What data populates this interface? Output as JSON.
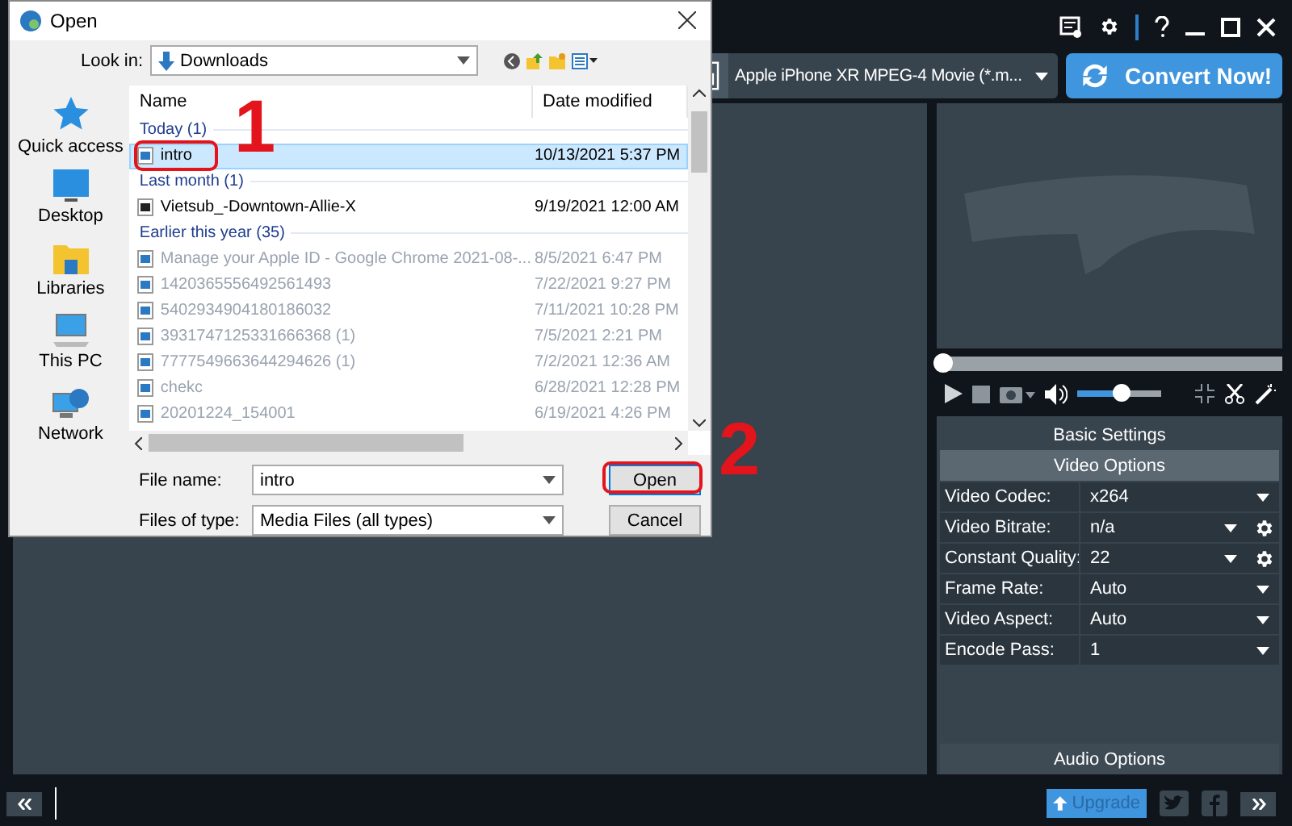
{
  "app": {
    "profile": "Apple iPhone XR MPEG-4 Movie (*.m...",
    "convert_button": "Convert Now!"
  },
  "player": {
    "seek": {
      "level": 0
    },
    "volume": {
      "level": 0.52
    }
  },
  "settings": {
    "sections": [
      {
        "title": "Basic Settings",
        "expanded": false
      },
      {
        "title": "Video Options",
        "expanded": true
      }
    ],
    "rows": [
      {
        "label": "Video Codec:",
        "value": "x264",
        "kind": "plain"
      },
      {
        "label": "Video Bitrate:",
        "value": "n/a",
        "kind": "gear"
      },
      {
        "label": "Constant Quality:",
        "value": "22",
        "kind": "gear"
      },
      {
        "label": "Frame Rate:",
        "value": "Auto",
        "kind": "plain"
      },
      {
        "label": "Video Aspect:",
        "value": "Auto",
        "kind": "plain"
      },
      {
        "label": "Encode Pass:",
        "value": "1",
        "kind": "plain"
      }
    ],
    "footer_section": {
      "title": "Audio Options",
      "expanded": false
    }
  },
  "bottom_bar": {
    "upgrade_button": "Upgrade"
  },
  "dialog": {
    "title": "Open",
    "look_in_label": "Look in:",
    "look_in": "Downloads",
    "places": [
      {
        "label": "Quick access",
        "kind": "star"
      },
      {
        "label": "Desktop",
        "kind": "desktop"
      },
      {
        "label": "Libraries",
        "kind": "folder"
      },
      {
        "label": "This PC",
        "kind": "pc"
      },
      {
        "label": "Network",
        "kind": "network"
      }
    ],
    "columns": [
      "Name",
      "Date modified"
    ],
    "groups": [
      {
        "title": "Today (1)",
        "files": [
          {
            "name": "intro",
            "date": "10/13/2021 5:37 PM",
            "selected": true,
            "kind": "video"
          }
        ]
      },
      {
        "title": "Last month (1)",
        "files": [
          {
            "name": "Vietsub_-Downtown-Allie-X",
            "date": "9/19/2021 12:00 AM",
            "selected": false,
            "kind": "audio"
          }
        ]
      },
      {
        "title": "Earlier this year (35)",
        "files": [
          {
            "name": "Manage your Apple ID - Google Chrome 2021-08-...",
            "date": "8/5/2021 6:47 PM",
            "selected": false,
            "kind": "video"
          },
          {
            "name": "1420365556492561493",
            "date": "7/22/2021 9:27 PM",
            "selected": false,
            "kind": "video"
          },
          {
            "name": "5402934904180186032",
            "date": "7/11/2021 10:28 PM",
            "selected": false,
            "kind": "video"
          },
          {
            "name": "3931747125331666368 (1)",
            "date": "7/5/2021 2:21 PM",
            "selected": false,
            "kind": "video"
          },
          {
            "name": "7777549663644294626 (1)",
            "date": "7/2/2021 12:36 AM",
            "selected": false,
            "kind": "video"
          },
          {
            "name": "chekc",
            "date": "6/28/2021 12:28 PM",
            "selected": false,
            "kind": "video"
          },
          {
            "name": "20201224_154001",
            "date": "6/19/2021 4:26 PM",
            "selected": false,
            "kind": "video"
          }
        ]
      }
    ],
    "file_name_label": "File name:",
    "file_name": "intro",
    "file_type_label": "Files of type:",
    "file_type": "Media Files (all types)",
    "open_button": "Open",
    "cancel_button": "Cancel"
  },
  "annotations": [
    "1",
    "2"
  ]
}
